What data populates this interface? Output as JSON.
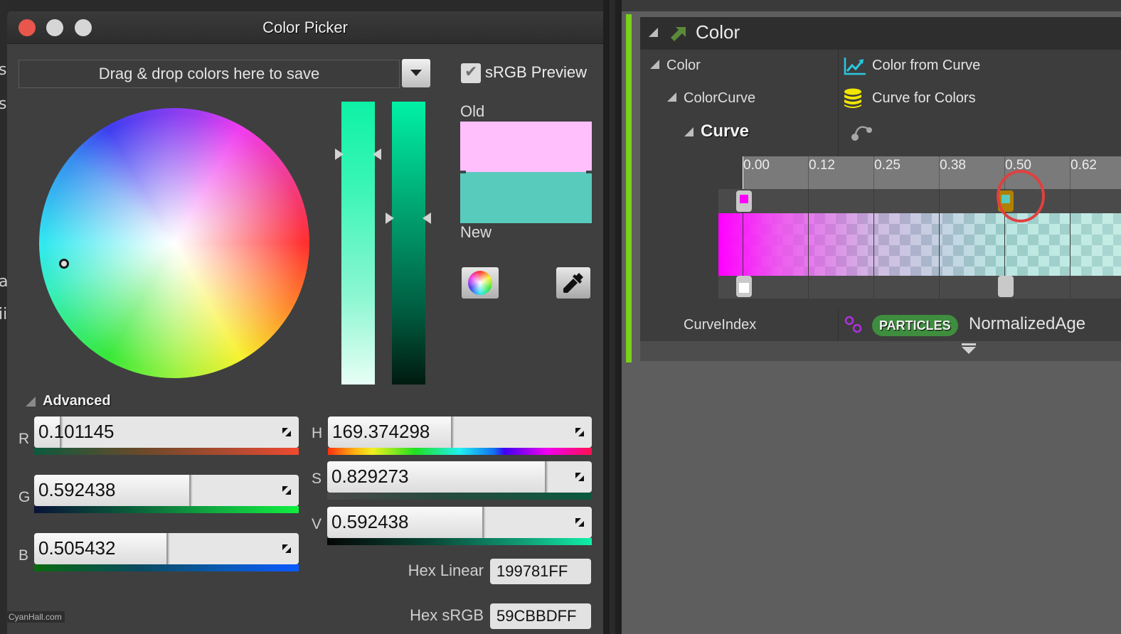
{
  "background": {
    "left_fragments": [
      "s",
      "s",
      "a",
      "ii"
    ]
  },
  "picker": {
    "title": "Color Picker",
    "window_controls": [
      "close",
      "minimize",
      "maximize"
    ],
    "dropzone_text": "Drag & drop colors here to save",
    "srgb_preview": {
      "label": "sRGB Preview",
      "checked": true
    },
    "old_label": "Old",
    "new_label": "New",
    "old_color": "#FFBFFD",
    "new_color": "#59CBBD",
    "wheel_button": "color-wheel-icon",
    "eyedropper_button": "eyedropper-icon",
    "advanced_label": "Advanced",
    "rgb": [
      {
        "label": "R",
        "value": "0.101145",
        "fraction": 0.101145
      },
      {
        "label": "G",
        "value": "0.592438",
        "fraction": 0.592438
      },
      {
        "label": "B",
        "value": "0.505432",
        "fraction": 0.505432
      }
    ],
    "hsv": [
      {
        "label": "H",
        "value": "169.374298",
        "fraction": 0.4705
      },
      {
        "label": "S",
        "value": "0.829273",
        "fraction": 0.829273
      },
      {
        "label": "V",
        "value": "0.592438",
        "fraction": 0.592438
      }
    ],
    "hex_linear": {
      "label": "Hex Linear",
      "value": "199781FF"
    },
    "hex_srgb": {
      "label": "Hex sRGB",
      "value": "59CBBDFF"
    },
    "watermark": "CyanHall.com"
  },
  "details": {
    "section_title": "Color",
    "rows": [
      {
        "label": "Color",
        "value": "Color from Curve",
        "icon": "chart-line-icon"
      },
      {
        "label": "ColorCurve",
        "value": "Curve for Colors",
        "icon": "database-stack-icon"
      },
      {
        "label": "Curve",
        "icon": "curve-edit-icon"
      }
    ],
    "timeline": {
      "ticks": [
        "0.00",
        "0.12",
        "0.25",
        "0.38",
        "0.50",
        "0.62"
      ],
      "color_keys": [
        {
          "time": 0.0,
          "color": "#FF00FF"
        },
        {
          "time": 0.5,
          "color": "#59CBBD",
          "selected": true
        }
      ],
      "alpha_keys": [
        {
          "time": 0.0,
          "color": "#FFFFFF"
        },
        {
          "time": 0.5,
          "color": "#C9C9C9"
        }
      ]
    },
    "curve_index": {
      "label": "CurveIndex",
      "badge": "PARTICLES",
      "value": "NormalizedAge",
      "icon": "link-icon"
    }
  }
}
